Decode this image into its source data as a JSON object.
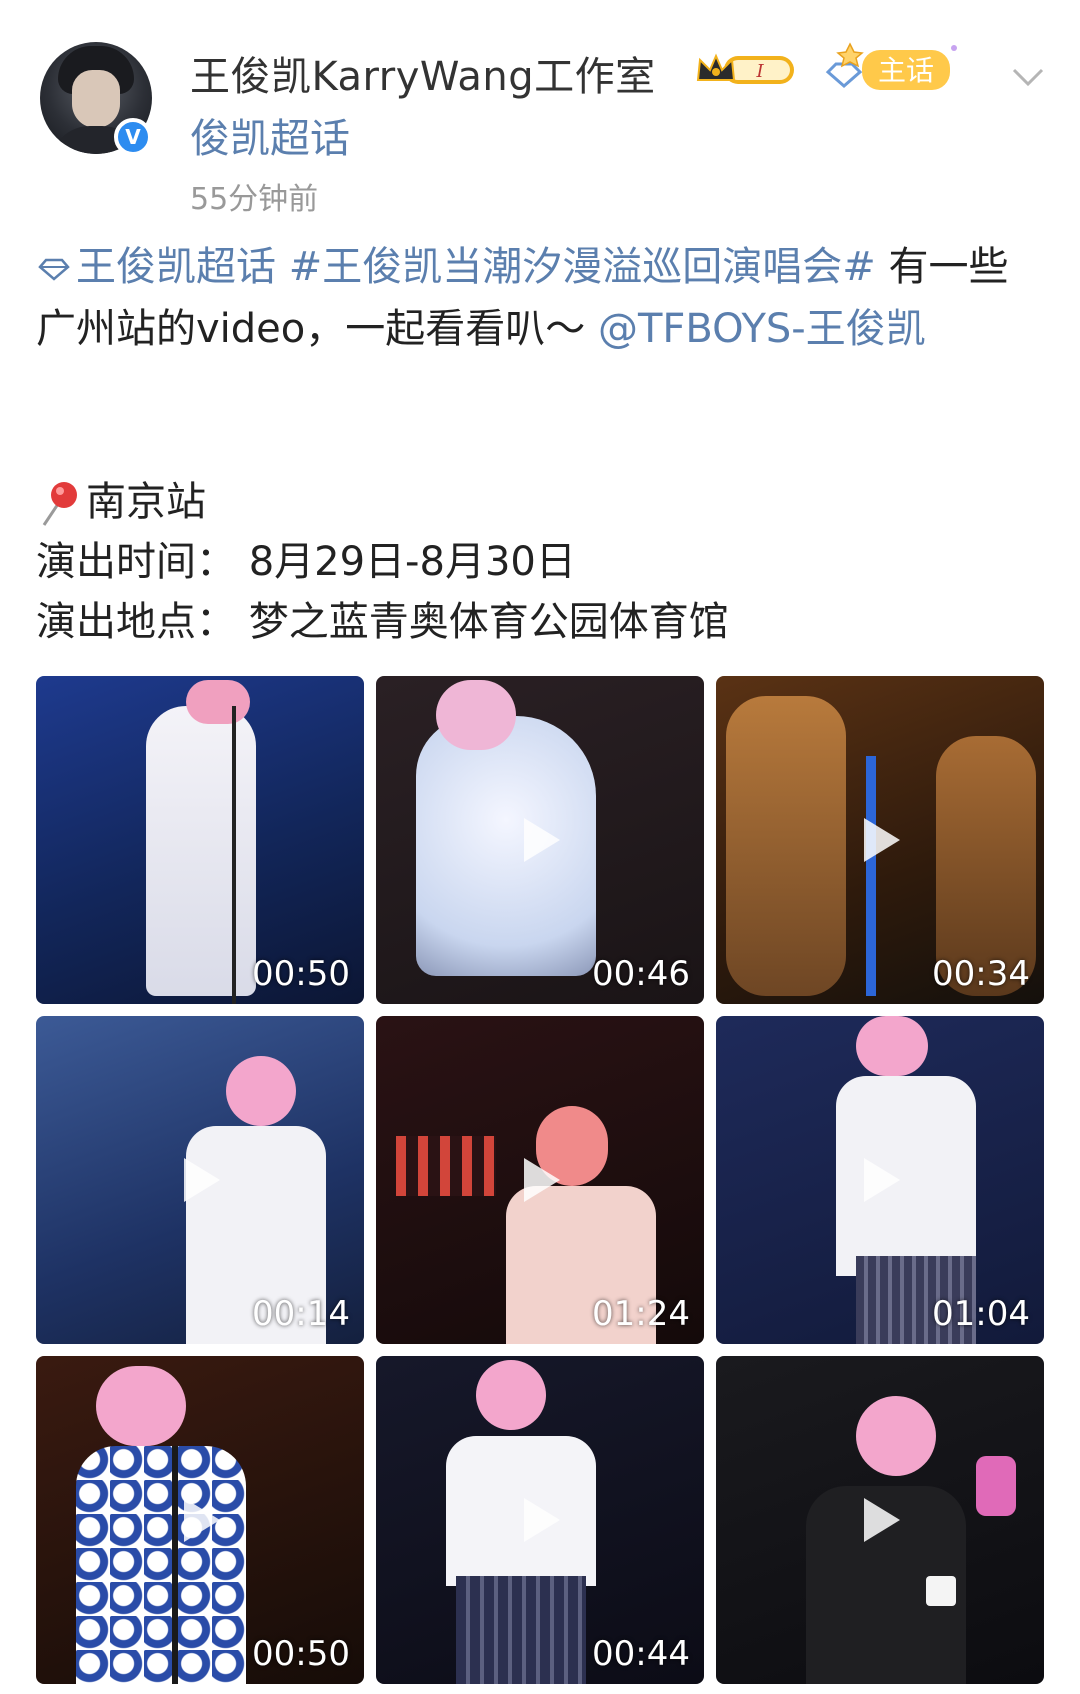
{
  "post": {
    "author_name": "王俊凯KarryWang工作室",
    "topic_source": "俊凯超话",
    "time": "55分钟前",
    "badge_level": "I",
    "badge_topic": "主话",
    "verified_label": "V"
  },
  "content": {
    "tag1": "王俊凯超话",
    "tag2": "#王俊凯当潮汐漫溢巡回演唱会#",
    "text": " 有一些广州站的video，一起看看叭～",
    "mention": "@TFBOYS-王俊凯"
  },
  "info": {
    "station": "南京站",
    "time_line": "演出时间：  8月29日-8月30日",
    "venue_line": "演出地点：  梦之蓝青奥体育公园体育馆"
  },
  "videos": [
    {
      "duration": "00:50"
    },
    {
      "duration": "00:46"
    },
    {
      "duration": "00:34"
    },
    {
      "duration": "00:14"
    },
    {
      "duration": "01:24"
    },
    {
      "duration": "01:04"
    },
    {
      "duration": "00:50"
    },
    {
      "duration": "00:44"
    },
    {
      "duration": ""
    }
  ],
  "colors": {
    "link": "#5b7fae",
    "verified": "#2d8cf0",
    "badge_gold": "#f2b21c"
  },
  "icons": {
    "verified": "verified-badge-icon",
    "chevron": "chevron-down-icon",
    "diamond": "super-topic-diamond-icon",
    "pin": "map-pin-icon",
    "play": "play-icon"
  }
}
